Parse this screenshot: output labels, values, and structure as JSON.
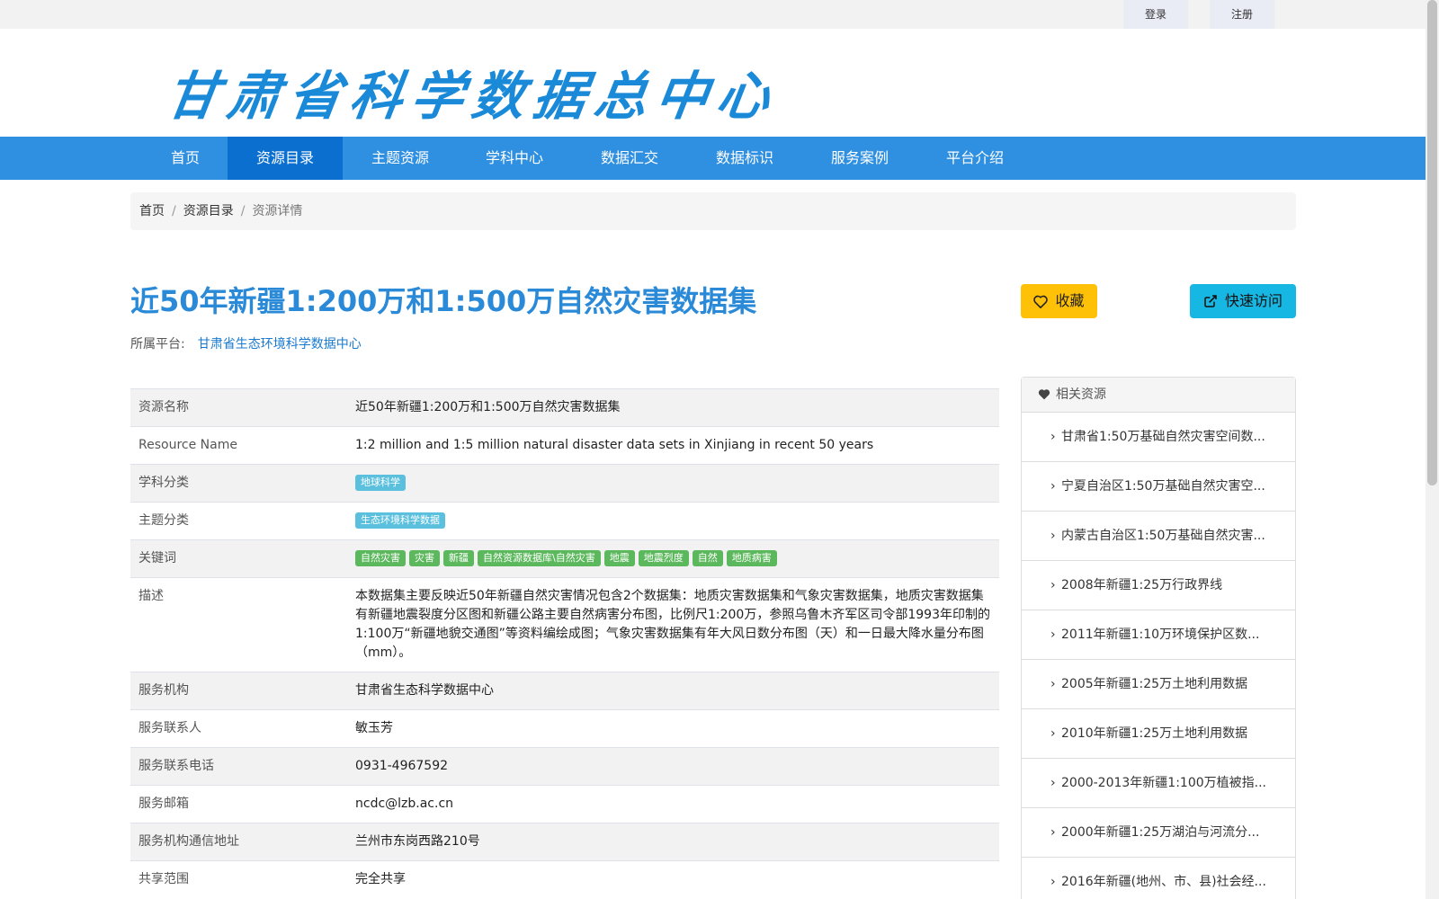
{
  "topbar": {
    "login": "登录",
    "register": "注册"
  },
  "header": {
    "logo_text": "甘肃省科学数据总中心"
  },
  "nav": {
    "items": [
      "首页",
      "资源目录",
      "主题资源",
      "学科中心",
      "数据汇交",
      "数据标识",
      "服务案例",
      "平台介绍"
    ],
    "active": "资源目录"
  },
  "breadcrumb": {
    "home": "首页",
    "catalog": "资源目录",
    "current": "资源详情",
    "separator": "/"
  },
  "resource": {
    "title": "近50年新疆1:200万和1:500万自然灾害数据集",
    "platform_label": "所属平台:",
    "platform_name": "甘肃省生态环境科学数据中心",
    "fav_button": "收藏",
    "visit_button": "快速访问"
  },
  "details": {
    "name_label": "资源名称",
    "name_value": "近50年新疆1:200万和1:500万自然灾害数据集",
    "en_label": "Resource Name",
    "en_value": "1:2 million and 1:5 million natural disaster data sets in Xinjiang in recent 50 years",
    "subject_label": "学科分类",
    "subject_tag": "地球科学",
    "theme_label": "主题分类",
    "theme_tag": "生态环境科学数据",
    "keywords_label": "关键词",
    "keywords": [
      "自然灾害",
      "灾害",
      "新疆",
      "自然资源数据库\\自然灾害",
      "地震",
      "地震烈度",
      "自然",
      "地质病害"
    ],
    "desc_label": "描述",
    "desc_value": "本数据集主要反映近50年新疆自然灾害情况包含2个数据集：地质灾害数据集和气象灾害数据集，地质灾害数据集有新疆地震裂度分区图和新疆公路主要自然病害分布图，比例尺1:200万，参照乌鲁木齐军区司令部1993年印制的1:100万“新疆地貌交通图”等资料编绘成图；气象灾害数据集有年大风日数分布图（天）和一日最大降水量分布图（mm）。",
    "org_label": "服务机构",
    "org_value": "甘肃省生态科学数据中心",
    "contact_label": "服务联系人",
    "contact_value": "敏玉芳",
    "phone_label": "服务联系电话",
    "phone_value": "0931-4967592",
    "email_label": "服务邮箱",
    "email_value": "ncdc@lzb.ac.cn",
    "address_label": "服务机构通信地址",
    "address_value": "兰州市东岗西路210号",
    "share_label": "共享范围",
    "share_value": "完全共享"
  },
  "sidebar": {
    "title": "相关资源",
    "items": [
      "甘肃省1:50万基础自然灾害空间数...",
      "宁夏自治区1:50万基础自然灾害空...",
      "内蒙古自治区1:50万基础自然灾害...",
      "2008年新疆1:25万行政界线",
      "2011年新疆1:10万环境保护区数...",
      "2005年新疆1:25万土地利用数据",
      "2010年新疆1:25万土地利用数据",
      "2000-2013年新疆1:100万植被指...",
      "2000年新疆1:25万湖泊与河流分...",
      "2016年新疆(地州、市、县)社会经..."
    ]
  },
  "colors": {
    "nav_bg": "#2f8fe0",
    "nav_active": "#0b6fd0",
    "title": "#2a8ad8",
    "fav_btn": "#ffc107",
    "visit_btn": "#17b7e3",
    "tag_blue": "#5bc0de",
    "tag_green": "#5cb85c"
  },
  "icons": {
    "fav": "heart-outline-icon",
    "visit": "external-link-icon",
    "sidebar_head": "heart-icon",
    "list": "chevron-right-icon"
  }
}
